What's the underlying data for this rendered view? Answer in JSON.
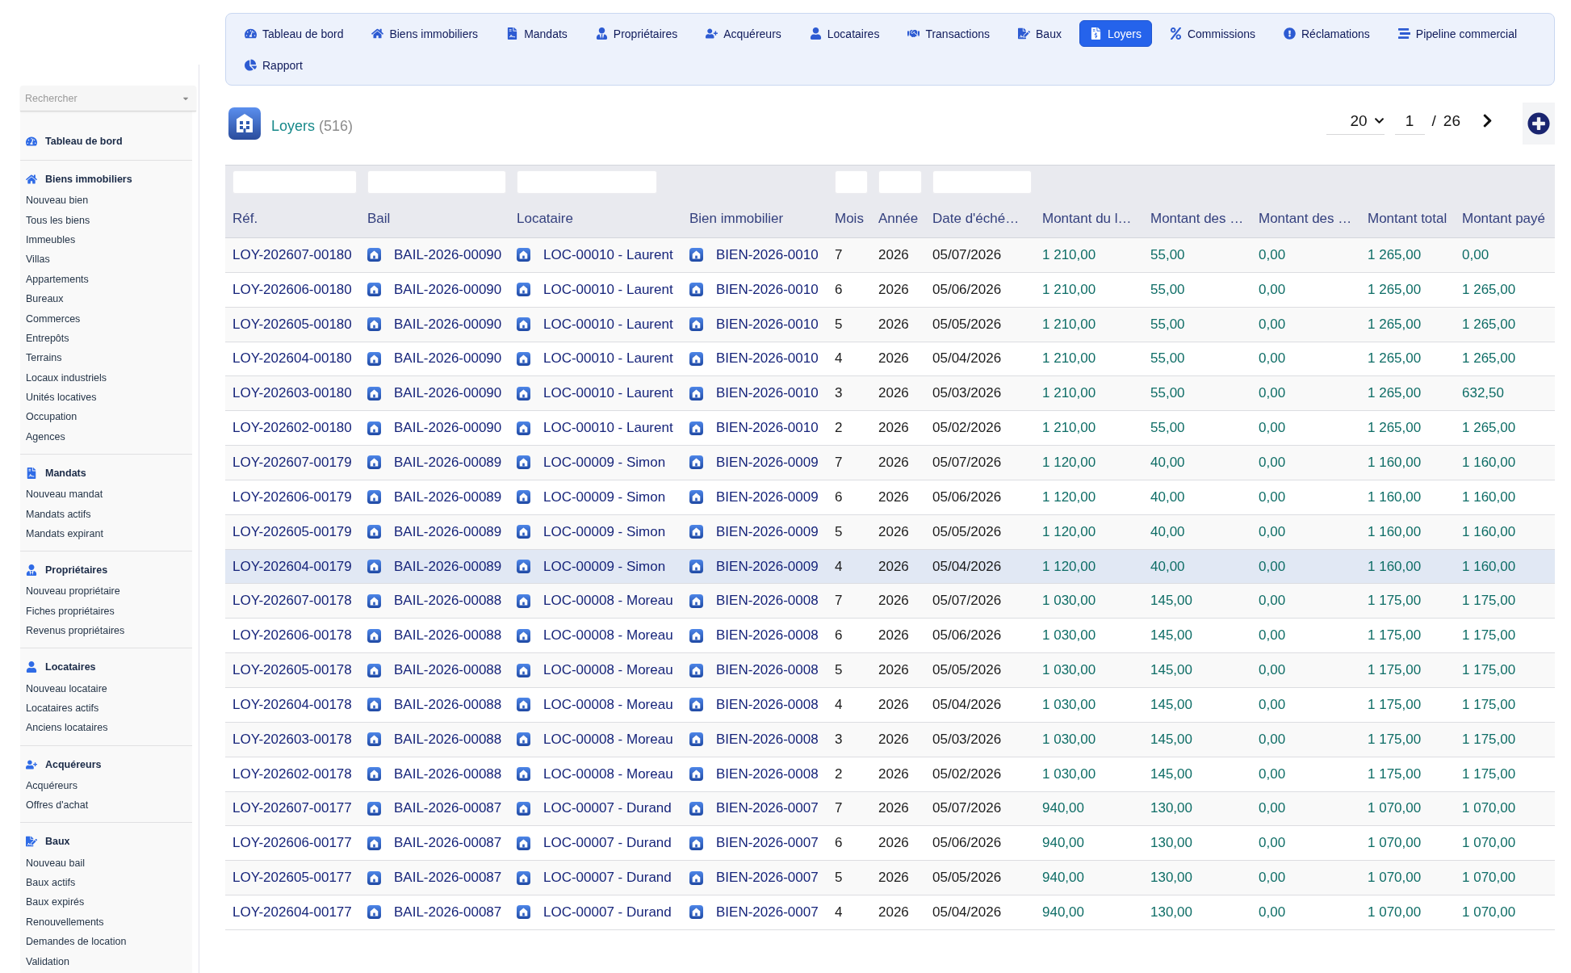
{
  "sidebar": {
    "search": {
      "placeholder": "Rechercher"
    },
    "sections": [
      {
        "title": "Tableau de bord"
      },
      {
        "title": "Biens immobiliers",
        "items": [
          "Nouveau bien",
          "Tous les biens",
          "Immeubles",
          "Villas",
          "Appartements",
          "Bureaux",
          "Commerces",
          "Entrepôts",
          "Terrains",
          "Locaux industriels",
          "Unités locatives",
          "Occupation",
          "Agences"
        ]
      },
      {
        "title": "Mandats",
        "items": [
          "Nouveau mandat",
          "Mandats actifs",
          "Mandats expirant"
        ]
      },
      {
        "title": "Propriétaires",
        "items": [
          "Nouveau propriétaire",
          "Fiches propriétaires",
          "Revenus propriétaires"
        ]
      },
      {
        "title": "Locataires",
        "items": [
          "Nouveau locataire",
          "Locataires actifs",
          "Anciens locataires"
        ]
      },
      {
        "title": "Acquéreurs",
        "items": [
          "Acquéreurs",
          "Offres d'achat"
        ]
      },
      {
        "title": "Baux",
        "items": [
          "Nouveau bail",
          "Baux actifs",
          "Baux expirés",
          "Renouvellements",
          "Demandes de location",
          "Validation"
        ]
      }
    ]
  },
  "nav_tabs": [
    {
      "label": "Tableau de bord",
      "selected": false
    },
    {
      "label": "Biens immobiliers",
      "selected": false
    },
    {
      "label": "Mandats",
      "selected": false
    },
    {
      "label": "Propriétaires",
      "selected": false
    },
    {
      "label": "Acquéreurs",
      "selected": false
    },
    {
      "label": "Locataires",
      "selected": false
    },
    {
      "label": "Transactions",
      "selected": false
    },
    {
      "label": "Baux",
      "selected": false
    },
    {
      "label": "Loyers",
      "selected": true
    },
    {
      "label": "Commissions",
      "selected": false
    },
    {
      "label": "Réclamations",
      "selected": false
    },
    {
      "label": "Pipeline commercial",
      "selected": false
    },
    {
      "label": "Rapport",
      "selected": false
    }
  ],
  "page_header": {
    "title": "Loyers",
    "count": "(516)"
  },
  "pagination": {
    "page_size": "20",
    "page": "1",
    "separator": "/",
    "page_count": "26"
  },
  "table": {
    "columns": [
      {
        "label": "Réf.",
        "kind": "link",
        "filter": true
      },
      {
        "label": "Bail",
        "kind": "record",
        "filter": true
      },
      {
        "label": "Locataire",
        "kind": "record",
        "filter": true
      },
      {
        "label": "Bien immobilier",
        "kind": "record",
        "filter": false
      },
      {
        "label": "Mois",
        "kind": "number",
        "filter": true
      },
      {
        "label": "Année",
        "kind": "number",
        "filter": true
      },
      {
        "label": "Date d'éché…",
        "kind": "date",
        "filter": true
      },
      {
        "label": "Montant du l…",
        "kind": "amount",
        "filter": false
      },
      {
        "label": "Montant des …",
        "kind": "amount",
        "filter": false
      },
      {
        "label": "Montant des …",
        "kind": "amount",
        "filter": false
      },
      {
        "label": "Montant total",
        "kind": "amount",
        "filter": false
      },
      {
        "label": "Montant payé",
        "kind": "amount",
        "filter": false
      }
    ],
    "rows": [
      {
        "selected": false,
        "cells": [
          "LOY-202607-00180",
          "BAIL-2026-00090",
          "LOC-00010 - Laurent",
          "BIEN-2026-0010",
          "7",
          "2026",
          "05/07/2026",
          "1 210,00",
          "55,00",
          "0,00",
          "1 265,00",
          "0,00"
        ]
      },
      {
        "selected": false,
        "cells": [
          "LOY-202606-00180",
          "BAIL-2026-00090",
          "LOC-00010 - Laurent",
          "BIEN-2026-0010",
          "6",
          "2026",
          "05/06/2026",
          "1 210,00",
          "55,00",
          "0,00",
          "1 265,00",
          "1 265,00"
        ]
      },
      {
        "selected": false,
        "cells": [
          "LOY-202605-00180",
          "BAIL-2026-00090",
          "LOC-00010 - Laurent",
          "BIEN-2026-0010",
          "5",
          "2026",
          "05/05/2026",
          "1 210,00",
          "55,00",
          "0,00",
          "1 265,00",
          "1 265,00"
        ]
      },
      {
        "selected": false,
        "cells": [
          "LOY-202604-00180",
          "BAIL-2026-00090",
          "LOC-00010 - Laurent",
          "BIEN-2026-0010",
          "4",
          "2026",
          "05/04/2026",
          "1 210,00",
          "55,00",
          "0,00",
          "1 265,00",
          "1 265,00"
        ]
      },
      {
        "selected": false,
        "cells": [
          "LOY-202603-00180",
          "BAIL-2026-00090",
          "LOC-00010 - Laurent",
          "BIEN-2026-0010",
          "3",
          "2026",
          "05/03/2026",
          "1 210,00",
          "55,00",
          "0,00",
          "1 265,00",
          "632,50"
        ]
      },
      {
        "selected": false,
        "cells": [
          "LOY-202602-00180",
          "BAIL-2026-00090",
          "LOC-00010 - Laurent",
          "BIEN-2026-0010",
          "2",
          "2026",
          "05/02/2026",
          "1 210,00",
          "55,00",
          "0,00",
          "1 265,00",
          "1 265,00"
        ]
      },
      {
        "selected": false,
        "cells": [
          "LOY-202607-00179",
          "BAIL-2026-00089",
          "LOC-00009 - Simon",
          "BIEN-2026-0009",
          "7",
          "2026",
          "05/07/2026",
          "1 120,00",
          "40,00",
          "0,00",
          "1 160,00",
          "1 160,00"
        ]
      },
      {
        "selected": false,
        "cells": [
          "LOY-202606-00179",
          "BAIL-2026-00089",
          "LOC-00009 - Simon",
          "BIEN-2026-0009",
          "6",
          "2026",
          "05/06/2026",
          "1 120,00",
          "40,00",
          "0,00",
          "1 160,00",
          "1 160,00"
        ]
      },
      {
        "selected": false,
        "cells": [
          "LOY-202605-00179",
          "BAIL-2026-00089",
          "LOC-00009 - Simon",
          "BIEN-2026-0009",
          "5",
          "2026",
          "05/05/2026",
          "1 120,00",
          "40,00",
          "0,00",
          "1 160,00",
          "1 160,00"
        ]
      },
      {
        "selected": true,
        "cells": [
          "LOY-202604-00179",
          "BAIL-2026-00089",
          "LOC-00009 - Simon",
          "BIEN-2026-0009",
          "4",
          "2026",
          "05/04/2026",
          "1 120,00",
          "40,00",
          "0,00",
          "1 160,00",
          "1 160,00"
        ]
      },
      {
        "selected": false,
        "cells": [
          "LOY-202607-00178",
          "BAIL-2026-00088",
          "LOC-00008 - Moreau",
          "BIEN-2026-0008",
          "7",
          "2026",
          "05/07/2026",
          "1 030,00",
          "145,00",
          "0,00",
          "1 175,00",
          "1 175,00"
        ]
      },
      {
        "selected": false,
        "cells": [
          "LOY-202606-00178",
          "BAIL-2026-00088",
          "LOC-00008 - Moreau",
          "BIEN-2026-0008",
          "6",
          "2026",
          "05/06/2026",
          "1 030,00",
          "145,00",
          "0,00",
          "1 175,00",
          "1 175,00"
        ]
      },
      {
        "selected": false,
        "cells": [
          "LOY-202605-00178",
          "BAIL-2026-00088",
          "LOC-00008 - Moreau",
          "BIEN-2026-0008",
          "5",
          "2026",
          "05/05/2026",
          "1 030,00",
          "145,00",
          "0,00",
          "1 175,00",
          "1 175,00"
        ]
      },
      {
        "selected": false,
        "cells": [
          "LOY-202604-00178",
          "BAIL-2026-00088",
          "LOC-00008 - Moreau",
          "BIEN-2026-0008",
          "4",
          "2026",
          "05/04/2026",
          "1 030,00",
          "145,00",
          "0,00",
          "1 175,00",
          "1 175,00"
        ]
      },
      {
        "selected": false,
        "cells": [
          "LOY-202603-00178",
          "BAIL-2026-00088",
          "LOC-00008 - Moreau",
          "BIEN-2026-0008",
          "3",
          "2026",
          "05/03/2026",
          "1 030,00",
          "145,00",
          "0,00",
          "1 175,00",
          "1 175,00"
        ]
      },
      {
        "selected": false,
        "cells": [
          "LOY-202602-00178",
          "BAIL-2026-00088",
          "LOC-00008 - Moreau",
          "BIEN-2026-0008",
          "2",
          "2026",
          "05/02/2026",
          "1 030,00",
          "145,00",
          "0,00",
          "1 175,00",
          "1 175,00"
        ]
      },
      {
        "selected": false,
        "cells": [
          "LOY-202607-00177",
          "BAIL-2026-00087",
          "LOC-00007 - Durand",
          "BIEN-2026-0007",
          "7",
          "2026",
          "05/07/2026",
          "940,00",
          "130,00",
          "0,00",
          "1 070,00",
          "1 070,00"
        ]
      },
      {
        "selected": false,
        "cells": [
          "LOY-202606-00177",
          "BAIL-2026-00087",
          "LOC-00007 - Durand",
          "BIEN-2026-0007",
          "6",
          "2026",
          "05/06/2026",
          "940,00",
          "130,00",
          "0,00",
          "1 070,00",
          "1 070,00"
        ]
      },
      {
        "selected": false,
        "cells": [
          "LOY-202605-00177",
          "BAIL-2026-00087",
          "LOC-00007 - Durand",
          "BIEN-2026-0007",
          "5",
          "2026",
          "05/05/2026",
          "940,00",
          "130,00",
          "0,00",
          "1 070,00",
          "1 070,00"
        ]
      },
      {
        "selected": false,
        "cells": [
          "LOY-202604-00177",
          "BAIL-2026-00087",
          "LOC-00007 - Durand",
          "BIEN-2026-0007",
          "4",
          "2026",
          "05/04/2026",
          "940,00",
          "130,00",
          "0,00",
          "1 070,00",
          "1 070,00"
        ]
      }
    ]
  }
}
